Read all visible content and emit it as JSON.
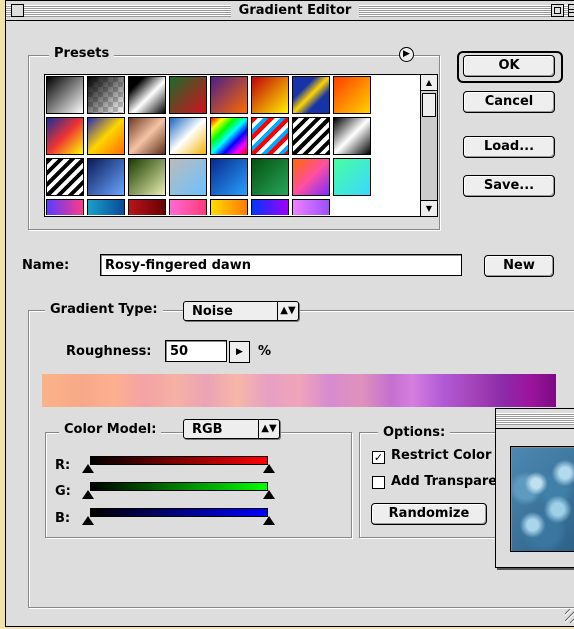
{
  "window": {
    "title": "Gradient Editor"
  },
  "presets": {
    "label": "Presets",
    "menu_icon": "right-arrow-circle-icon",
    "swatches": [
      "linear-gradient(135deg,#000,#fff)",
      "linear-gradient(135deg,#000,rgba(0,0,0,0))",
      "linear-gradient(135deg,#000 20%,#fff 55%,#000)",
      "linear-gradient(135deg,#1b6b2a,#d4101d)",
      "linear-gradient(135deg,#4a1e8a,#ff6a00)",
      "linear-gradient(135deg,#c0000b,#fff200)",
      "linear-gradient(135deg,#1733a8 30%,#ffd400 50%,#1733a8 70%)",
      "linear-gradient(135deg,#ff3d00,#ffd200)",
      "linear-gradient(135deg,#1a2e9a,#e33 50%,#ff0)",
      "linear-gradient(135deg,#2b2ab4,#ffd500 50%,#ff6a00)",
      "linear-gradient(135deg,#6b3a24,#f5c3a4 50%,#5c2d16)",
      "linear-gradient(135deg,#1665c1,#fff 50%,#f2b200)",
      "linear-gradient(135deg,#f00,#ff0,#0f0,#0ff,#00f,#f0f,#f00)",
      "repeating-linear-gradient(135deg,#f00 0 4px,#fff 4px 8px,#0af 8px 12px)",
      "repeating-linear-gradient(135deg,#000 0 4px,#fff 4px 8px)",
      "linear-gradient(135deg,#000,#fff 50%,#000)",
      "repeating-linear-gradient(135deg,#000 0 4px,#fff 4px 8px)",
      "linear-gradient(135deg,#0a1b5a,#6aa6ff)",
      "linear-gradient(135deg,#1a3a00,#e8f0b0)",
      "linear-gradient(135deg,#bbb,#6bc1ff)",
      "linear-gradient(135deg,#062a8c,#2aa0ff)",
      "linear-gradient(135deg,#035210,#29a55a)",
      "linear-gradient(135deg,#ff6a00,#ff4fa0 50%,#7b2dff)",
      "linear-gradient(135deg,#48ffa0,#3ad8ff)",
      "linear-gradient(90deg,#5a3bff,#ff3a8a)",
      "linear-gradient(90deg,#1aa0c8,#0a4a9a)",
      "linear-gradient(90deg,#b6151a,#6a0003)",
      "linear-gradient(90deg,#ff6ad5,#ff3a7a)",
      "linear-gradient(90deg,#ffdc00,#ff7a00)",
      "linear-gradient(90deg,#0036ff,#a000ff)",
      "linear-gradient(90deg,#f080ff,#9b50ff)"
    ]
  },
  "buttons": {
    "ok": "OK",
    "cancel": "Cancel",
    "load": "Load...",
    "save": "Save...",
    "new": "New"
  },
  "name": {
    "label": "Name:",
    "value": "Rosy-fingered dawn"
  },
  "gradient_type": {
    "label": "Gradient Type:",
    "value": "Noise",
    "roughness_label": "Roughness:",
    "roughness_value": "50",
    "roughness_unit": "%"
  },
  "color_model": {
    "label": "Color Model:",
    "value": "RGB",
    "channels": [
      {
        "label": "R:",
        "color": "#ff0000"
      },
      {
        "label": "G:",
        "color": "#00ff00"
      },
      {
        "label": "B:",
        "color": "#0000ff"
      }
    ]
  },
  "options": {
    "label": "Options:",
    "restrict": {
      "label": "Restrict Color",
      "checked": true
    },
    "transparency": {
      "label": "Add Transparency",
      "checked": false
    },
    "randomize": "Randomize"
  },
  "preview_window": {
    "thumbnail": "blue-bubbles-image"
  }
}
